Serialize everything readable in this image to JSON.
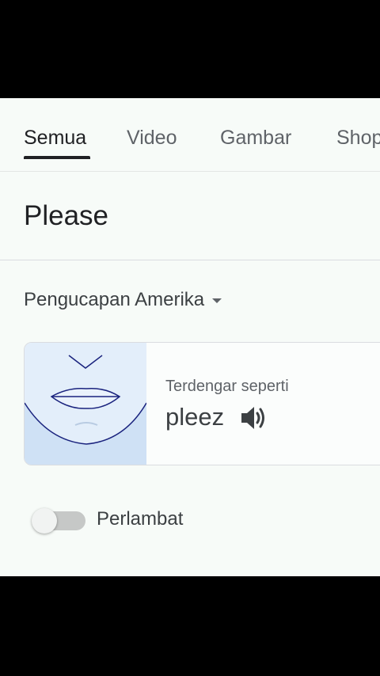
{
  "tabs": {
    "all": "Semua",
    "video": "Video",
    "images": "Gambar",
    "shop": "Shop"
  },
  "word": "Please",
  "pronunciation": {
    "dialect": "Pengucapan Amerika",
    "sounds_like_label": "Terdengar seperti",
    "phonetic": "pleez",
    "speaker_icon": "volume-icon"
  },
  "slow_toggle": {
    "label": "Perlambat",
    "state": "off"
  }
}
